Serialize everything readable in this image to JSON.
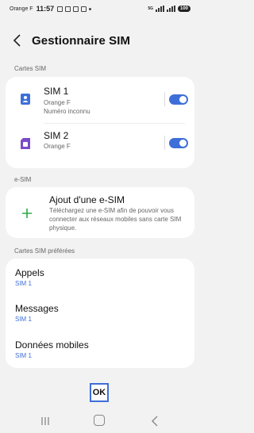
{
  "status_bar": {
    "carrier": "Orange F",
    "time": "11:57",
    "network": "5G",
    "battery": "100"
  },
  "header": {
    "title": "Gestionnaire SIM"
  },
  "sim_cards": {
    "section_label": "Cartes SIM",
    "items": [
      {
        "name": "SIM 1",
        "operator": "Orange F",
        "number": "Numéro inconnu",
        "enabled": true,
        "icon": "sim-person-icon",
        "color": "#3e6fd8"
      },
      {
        "name": "SIM 2",
        "operator": "Orange F",
        "enabled": true,
        "icon": "sim-card-icon",
        "color": "#7b4cc8"
      }
    ]
  },
  "esim": {
    "section_label": "e-SIM",
    "title": "Ajout d'une e-SIM",
    "description": "Téléchargez une e-SIM afin de pouvoir vous connecter aux réseaux mobiles sans carte SIM physique.",
    "icon": "plus-icon",
    "icon_color": "#2ea84a"
  },
  "preferred": {
    "section_label": "Cartes SIM préférées",
    "items": [
      {
        "title": "Appels",
        "value": "SIM 1"
      },
      {
        "title": "Messages",
        "value": "SIM 1"
      },
      {
        "title": "Données mobiles",
        "value": "SIM 1"
      }
    ]
  },
  "ok_button": {
    "label": "OK"
  },
  "colors": {
    "accent": "#3e6fd8",
    "background": "#f2f2f2"
  }
}
